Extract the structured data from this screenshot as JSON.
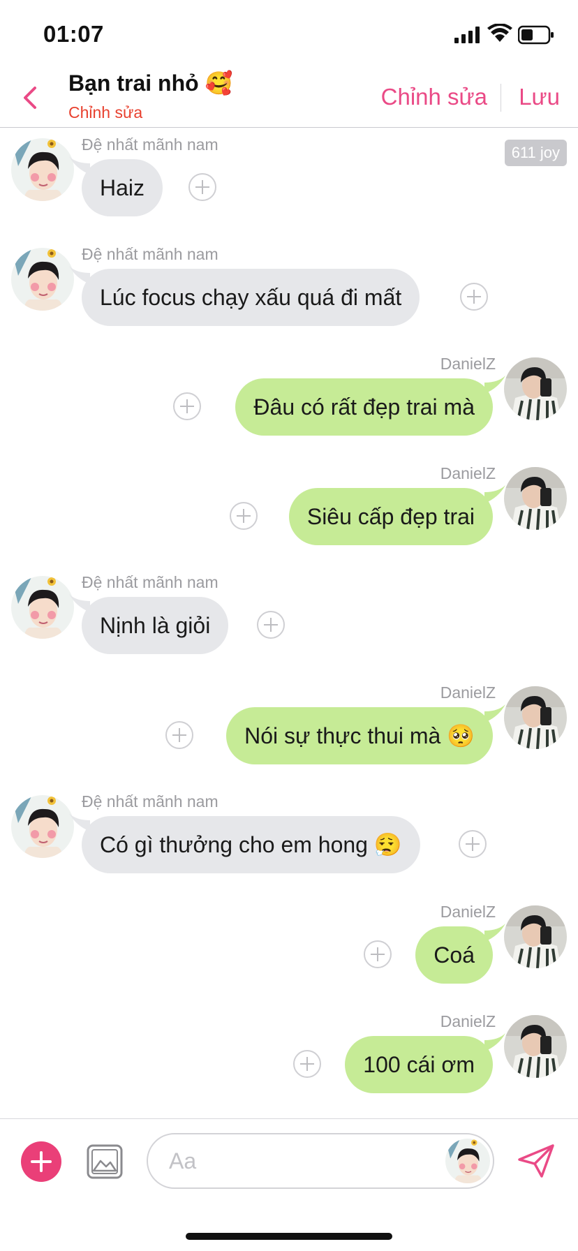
{
  "status_bar": {
    "time": "01:07"
  },
  "header": {
    "title": "Bạn trai nhỏ 🥰",
    "subtitle": "Chỉnh sửa",
    "edit_label": "Chỉnh sửa",
    "save_label": "Lưu"
  },
  "joy_badge": "611 joy",
  "messages": [
    {
      "side": "left",
      "sender": "Đệ nhất mãnh nam",
      "text": "Haiz"
    },
    {
      "side": "left",
      "sender": "Đệ nhất mãnh nam",
      "text": "Lúc focus chạy xấu quá đi mất"
    },
    {
      "side": "right",
      "sender": "DanielZ",
      "text": "Đâu có rất đẹp trai mà"
    },
    {
      "side": "right",
      "sender": "DanielZ",
      "text": "Siêu cấp đẹp trai"
    },
    {
      "side": "left",
      "sender": "Đệ nhất mãnh nam",
      "text": "Nịnh là giỏi"
    },
    {
      "side": "right",
      "sender": "DanielZ",
      "text": "Nói sự thực thui mà 🥺"
    },
    {
      "side": "left",
      "sender": "Đệ nhất mãnh nam",
      "text": "Có gì thưởng cho em hong 😮‍💨"
    },
    {
      "side": "right",
      "sender": "DanielZ",
      "text": "Coá"
    },
    {
      "side": "right",
      "sender": "DanielZ",
      "text": "100 cái ơm"
    }
  ],
  "input": {
    "placeholder": "Aa"
  },
  "icons": {
    "back": "chevron-left-icon",
    "add": "plus-icon",
    "gallery": "image-icon",
    "send": "send-icon",
    "reaction": "plus-icon"
  },
  "colors": {
    "accent": "#ea4a86",
    "subtitle": "#e8402e",
    "incoming_bubble": "#e6e7ea",
    "outgoing_bubble": "#c6eb96"
  }
}
